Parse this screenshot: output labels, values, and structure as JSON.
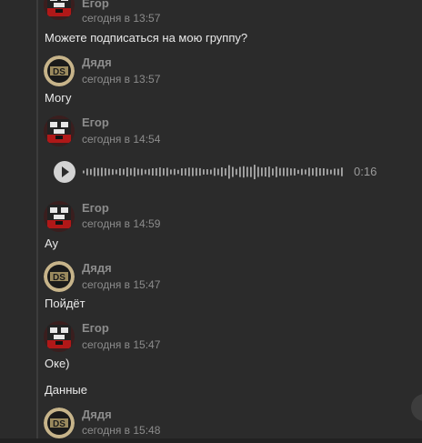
{
  "messages": [
    {
      "author": "Егор",
      "time": "сегодня в 13:57",
      "text": "Можете подписаться на мою группу?",
      "avatar": "egor-avatar"
    },
    {
      "author": "Дядя",
      "time": "сегодня в 13:57",
      "text": "Могу",
      "avatar": "dyadya-avatar"
    },
    {
      "author": "Егор",
      "time": "сегодня в 14:54",
      "voice_duration": "0:16",
      "avatar": "egor-avatar"
    },
    {
      "author": "Егор",
      "time": "сегодня в 14:59",
      "text": "Ау",
      "avatar": "egor-avatar"
    },
    {
      "author": "Дядя",
      "time": "сегодня в 15:47",
      "text": "Пойдёт",
      "avatar": "dyadya-avatar"
    },
    {
      "author": "Егор",
      "time": "сегодня в 15:47",
      "text": "Оке)",
      "text2": "Данные",
      "avatar": "egor-avatar"
    },
    {
      "author": "Дядя",
      "time": "сегодня в 15:48",
      "avatar": "dyadya-avatar"
    }
  ],
  "icons": {
    "play": "play-icon",
    "waveform": "waveform-icon",
    "scroll": "scroll-down-icon"
  },
  "colors": {
    "background": "#2b2b2b",
    "text": "#eaeaea",
    "meta": "#8c8c8c"
  }
}
